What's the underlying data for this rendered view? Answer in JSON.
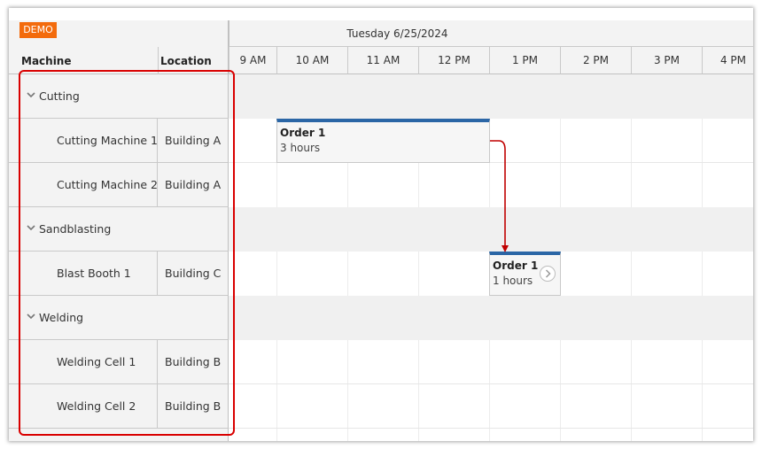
{
  "demo_label": "DEMO",
  "header": {
    "date": "Tuesday 6/25/2024",
    "columns": {
      "machine": "Machine",
      "location": "Location"
    },
    "hours": [
      "9 AM",
      "10 AM",
      "11 AM",
      "12 PM",
      "1 PM",
      "2 PM",
      "3 PM",
      "4 PM"
    ]
  },
  "groups": [
    {
      "name": "Cutting",
      "resources": [
        {
          "name": "Cutting Machine 1",
          "location": "Building A"
        },
        {
          "name": "Cutting Machine 2",
          "location": "Building A"
        }
      ]
    },
    {
      "name": "Sandblasting",
      "resources": [
        {
          "name": "Blast Booth 1",
          "location": "Building C"
        }
      ]
    },
    {
      "name": "Welding",
      "resources": [
        {
          "name": "Welding Cell 1",
          "location": "Building B"
        },
        {
          "name": "Welding Cell 2",
          "location": "Building B"
        }
      ]
    }
  ],
  "events": [
    {
      "title": "Order 1",
      "duration": "3 hours"
    },
    {
      "title": "Order 1",
      "duration": "1 hours"
    }
  ],
  "colors": {
    "event_bar": "#2b66a6",
    "link": "#c00000",
    "highlight": "#d90000",
    "demo": "#f36b0c"
  },
  "icons": {
    "collapse": "chevron-down-icon",
    "event_action": "chevron-right-circle-icon"
  }
}
